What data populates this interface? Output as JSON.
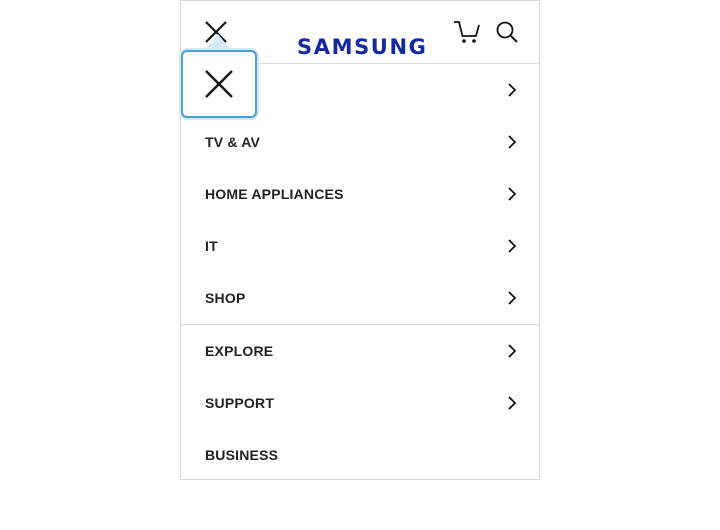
{
  "header": {
    "logo_text": "SAMSUNG",
    "brand_color": "#1428a0",
    "icons": [
      "close-icon",
      "cart-icon",
      "search-icon"
    ]
  },
  "menu": {
    "group1": [
      {
        "label": "",
        "has_chevron": true
      },
      {
        "label": "TV & AV",
        "has_chevron": true
      },
      {
        "label": "HOME APPLIANCES",
        "has_chevron": true
      },
      {
        "label": "IT",
        "has_chevron": true
      },
      {
        "label": "SHOP",
        "has_chevron": true
      }
    ],
    "group2": [
      {
        "label": "EXPLORE",
        "has_chevron": true
      },
      {
        "label": "SUPPORT",
        "has_chevron": true
      },
      {
        "label": "BUSINESS",
        "has_chevron": false
      }
    ]
  },
  "focus_color": "#4a9fd5"
}
